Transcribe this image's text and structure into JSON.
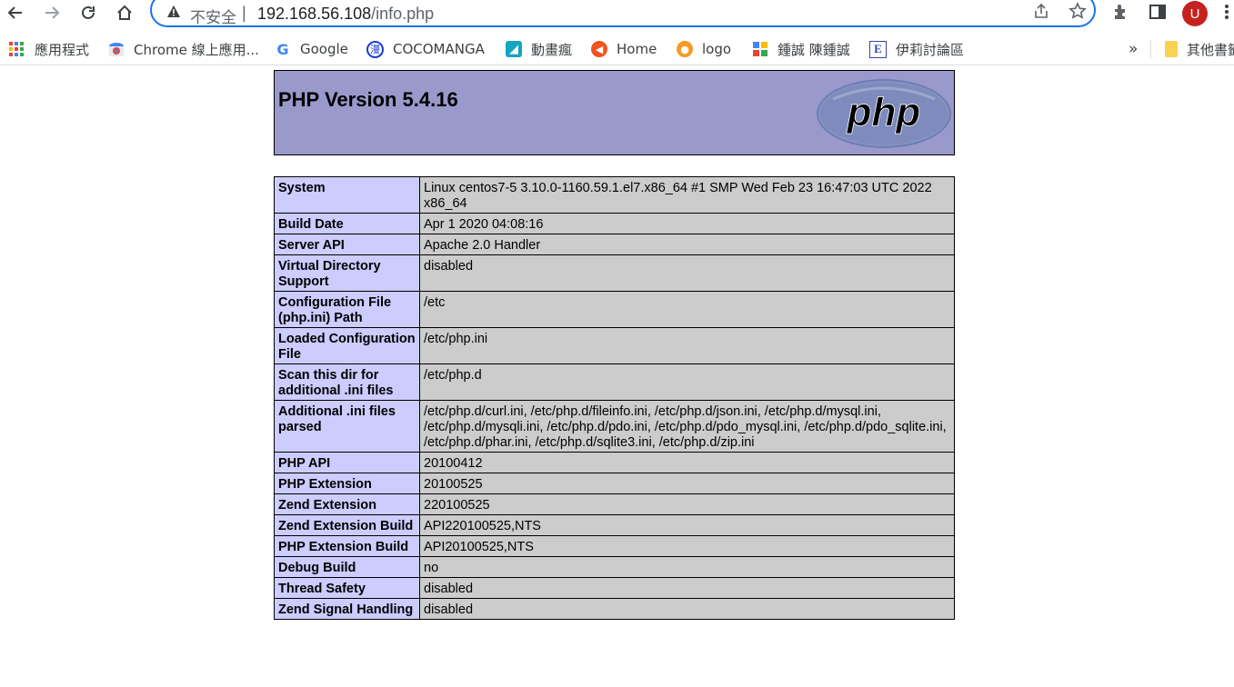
{
  "browser": {
    "insecure_label": "不安全",
    "separator": "|",
    "url_host": "192.168.56.108",
    "url_path": "/info.php",
    "avatar_letter": "U",
    "icons": [
      "back-icon",
      "forward-icon",
      "reload-icon",
      "home-icon",
      "warning-icon",
      "share-icon",
      "star-icon",
      "extensions-icon",
      "side-panel-icon",
      "menu-icon"
    ]
  },
  "bookmarks": {
    "items": [
      {
        "label": "應用程式",
        "icon": "apps-icon"
      },
      {
        "label": "Chrome 線上應用...",
        "icon": "chrome-webstore-icon"
      },
      {
        "label": "Google",
        "icon": "google-icon"
      },
      {
        "label": "COCOMANGA",
        "icon": "cocomanga-icon"
      },
      {
        "label": "動畫瘋",
        "icon": "anime-icon"
      },
      {
        "label": "Home",
        "icon": "home-bookmark-icon"
      },
      {
        "label": "logo",
        "icon": "logo-icon"
      },
      {
        "label": "鍾誠 陳鍾誠",
        "icon": "puzzle-icon"
      },
      {
        "label": "伊莉討論區",
        "icon": "eyny-icon"
      }
    ],
    "overflow": "»",
    "other_label": "其他書籤"
  },
  "page": {
    "title": "PHP Version 5.4.16",
    "logo_text": "php",
    "rows": [
      {
        "key": "System",
        "value": "Linux centos7-5 3.10.0-1160.59.1.el7.x86_64 #1 SMP Wed Feb 23 16:47:03 UTC 2022 x86_64"
      },
      {
        "key": "Build Date",
        "value": "Apr 1 2020 04:08:16"
      },
      {
        "key": "Server API",
        "value": "Apache 2.0 Handler"
      },
      {
        "key": "Virtual Directory Support",
        "value": "disabled"
      },
      {
        "key": "Configuration File (php.ini) Path",
        "value": "/etc"
      },
      {
        "key": "Loaded Configuration File",
        "value": "/etc/php.ini"
      },
      {
        "key": "Scan this dir for additional .ini files",
        "value": "/etc/php.d"
      },
      {
        "key": "Additional .ini files parsed",
        "value": "/etc/php.d/curl.ini, /etc/php.d/fileinfo.ini, /etc/php.d/json.ini, /etc/php.d/mysql.ini, /etc/php.d/mysqli.ini, /etc/php.d/pdo.ini, /etc/php.d/pdo_mysql.ini, /etc/php.d/pdo_sqlite.ini, /etc/php.d/phar.ini, /etc/php.d/sqlite3.ini, /etc/php.d/zip.ini"
      },
      {
        "key": "PHP API",
        "value": "20100412"
      },
      {
        "key": "PHP Extension",
        "value": "20100525"
      },
      {
        "key": "Zend Extension",
        "value": "220100525"
      },
      {
        "key": "Zend Extension Build",
        "value": "API220100525,NTS"
      },
      {
        "key": "PHP Extension Build",
        "value": "API20100525,NTS"
      },
      {
        "key": "Debug Build",
        "value": "no"
      },
      {
        "key": "Thread Safety",
        "value": "disabled"
      },
      {
        "key": "Zend Signal Handling",
        "value": "disabled"
      }
    ]
  }
}
